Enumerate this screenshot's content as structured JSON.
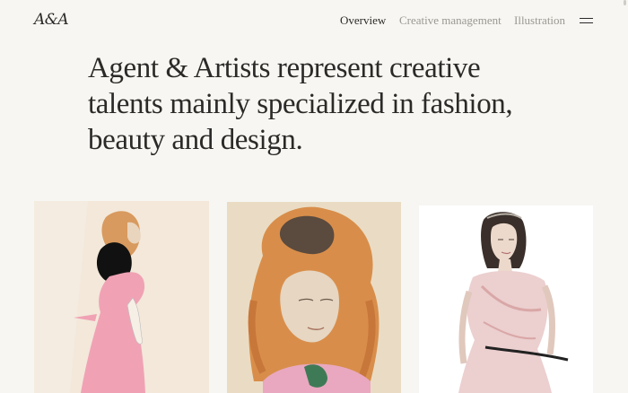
{
  "brand": {
    "logo_text": "A&A"
  },
  "nav": {
    "items": [
      {
        "label": "Overview",
        "active": true
      },
      {
        "label": "Creative management",
        "active": false
      },
      {
        "label": "Illustration",
        "active": false
      }
    ],
    "menu_icon": "hamburger-menu-icon"
  },
  "hero": {
    "headline": "Agent & Artists represent creative talents mainly specialized in fashion, beauty and design."
  },
  "gallery": {
    "items": [
      {
        "subject": "woman in pink dress illustration",
        "accent": "#f0a2b4"
      },
      {
        "subject": "portrait with orange curly hair illustration",
        "accent": "#d88e4a"
      },
      {
        "subject": "woman in draped pink gown illustration",
        "accent": "#e9c6c4"
      }
    ]
  },
  "colors": {
    "background": "#f7f6f2",
    "text": "#2b2a28",
    "muted_nav": "#9a9891"
  }
}
